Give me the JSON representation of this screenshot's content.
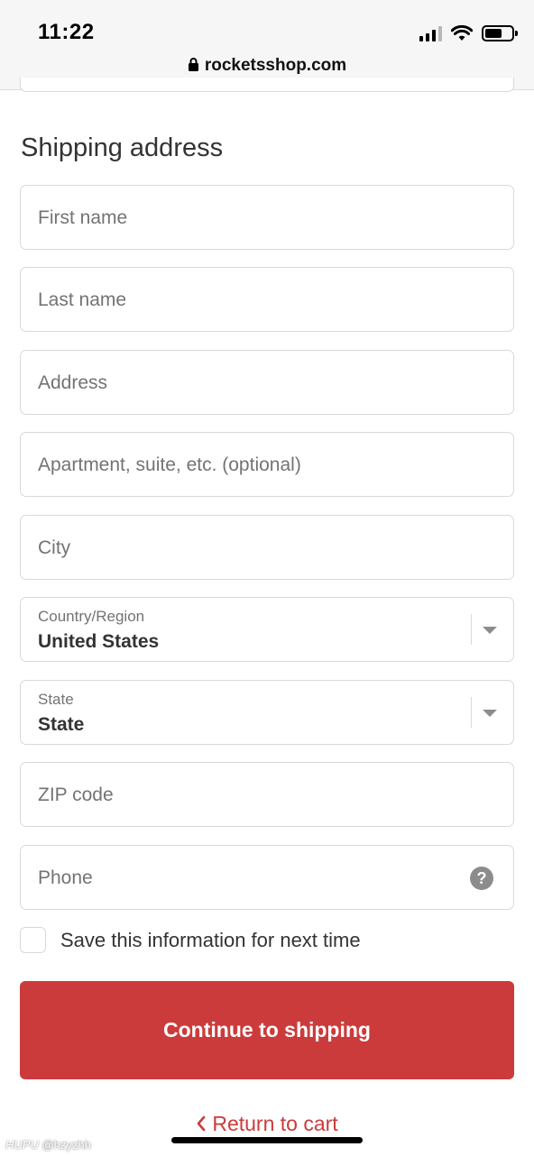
{
  "status_bar": {
    "time": "11:22"
  },
  "browser": {
    "url": "rocketsshop.com"
  },
  "form": {
    "heading": "Shipping address",
    "fields": {
      "first_name": {
        "placeholder": "First name"
      },
      "last_name": {
        "placeholder": "Last name"
      },
      "address": {
        "placeholder": "Address"
      },
      "apartment": {
        "placeholder": "Apartment, suite, etc. (optional)"
      },
      "city": {
        "placeholder": "City"
      },
      "country": {
        "label": "Country/Region",
        "value": "United States"
      },
      "state": {
        "label": "State",
        "value": "State"
      },
      "zip": {
        "placeholder": "ZIP code"
      },
      "phone": {
        "placeholder": "Phone"
      }
    },
    "save_info_label": "Save this information for next time",
    "continue_label": "Continue to shipping",
    "return_label": "Return to cart"
  },
  "watermark": {
    "brand": "HUPU",
    "handle": "@hzyzhh"
  },
  "colors": {
    "accent": "#cc3b3b",
    "border": "#d9d9d9",
    "placeholder": "#737373"
  },
  "icons": [
    "lock-icon",
    "signal-icon",
    "wifi-icon",
    "battery-icon",
    "chevron-down-icon",
    "help-icon",
    "chevron-left-icon"
  ]
}
